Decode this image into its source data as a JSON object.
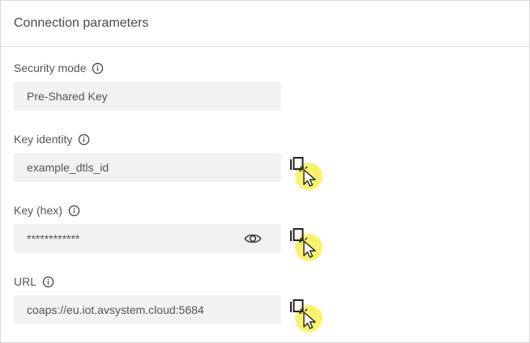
{
  "panel": {
    "title": "Connection parameters"
  },
  "fields": {
    "security_mode": {
      "label": "Security mode",
      "value": "Pre-Shared Key"
    },
    "key_identity": {
      "label": "Key identity",
      "value": "example_dtls_id"
    },
    "key_hex": {
      "label": "Key (hex)",
      "value": "************"
    },
    "url": {
      "label": "URL",
      "value": "coaps://eu.iot.avsystem.cloud:5684"
    }
  },
  "icons": {
    "info": "info-icon",
    "copy": "copy-icon",
    "reveal": "eye-icon",
    "cursor": "pointer-click-icon"
  },
  "colors": {
    "field_background": "#f2f2f2",
    "cursor_highlight": "#f7f26a"
  }
}
